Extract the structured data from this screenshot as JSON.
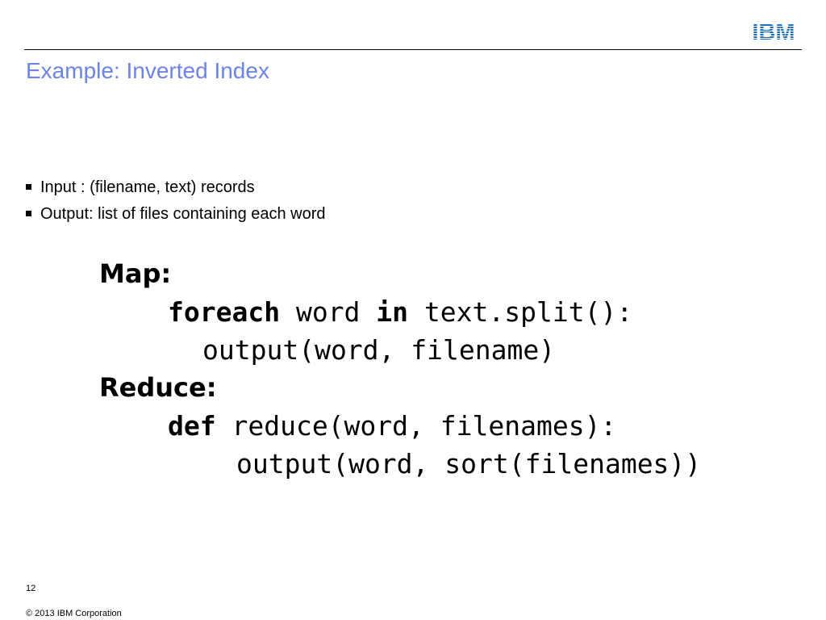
{
  "header": {
    "logo_text": "IBM",
    "brand_color": "#1F70C1"
  },
  "slide": {
    "title": "Example: Inverted Index",
    "title_color": "#6D83E6",
    "bullets": [
      "Input : (filename, text) records",
      "Output: list of files containing each word"
    ]
  },
  "code": {
    "map_label": "Map:",
    "map_keyword_foreach": "foreach",
    "map_word": " word ",
    "map_keyword_in": "in",
    "map_split": " text.split():",
    "map_output": "output(word, filename)",
    "reduce_label": "Reduce:",
    "reduce_keyword_def": "def",
    "reduce_signature": " reduce(word, filenames):",
    "reduce_output": "output(word, sort(filenames))"
  },
  "footer": {
    "page_number": "12",
    "copyright": "© 2013 IBM Corporation"
  }
}
